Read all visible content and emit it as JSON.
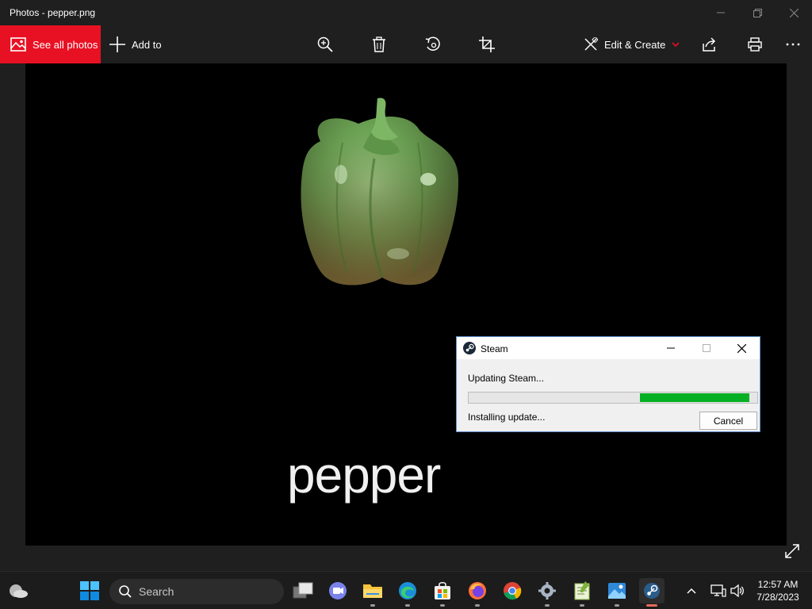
{
  "window": {
    "title": "Photos - pepper.png"
  },
  "toolbar": {
    "see_all_label": "See all photos",
    "add_to_label": "Add to",
    "edit_create_label": "Edit & Create",
    "icons": [
      "zoom-icon",
      "delete-icon",
      "rotate-icon",
      "crop-icon",
      "share-icon",
      "print-icon",
      "more-icon"
    ]
  },
  "image": {
    "caption": "pepper"
  },
  "steam_dialog": {
    "title": "Steam",
    "status": "Updating Steam...",
    "progress": 0.38,
    "substatus": "Installing update...",
    "cancel_label": "Cancel"
  },
  "taskbar": {
    "search_placeholder": "Search",
    "apps": [
      "task-view",
      "teams-chat",
      "file-explorer",
      "edge",
      "microsoft-store",
      "firefox",
      "chrome",
      "settings",
      "notepad-plus-plus",
      "photos",
      "steam"
    ],
    "time": "12:57 AM",
    "date": "7/28/2023"
  },
  "colors": {
    "accent_red": "#e81123",
    "progress_green": "#06b025",
    "taskbar_bg": "#1c1c1c"
  }
}
